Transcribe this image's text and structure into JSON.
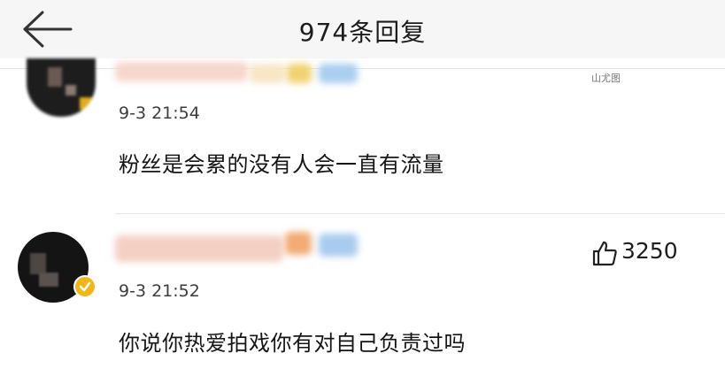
{
  "header": {
    "title": "974条回复",
    "back_icon": "back-arrow-icon"
  },
  "watermark": "山尤图",
  "comments": [
    {
      "time": "9-3 21:54",
      "content": "粉丝是会累的没有人会一直有流量"
    },
    {
      "time": "9-3 21:52",
      "content": "你说你热爱拍戏你有对自己负责过吗",
      "like_count": "3250",
      "like_icon": "thumbs-up-icon",
      "verified_badge": true
    }
  ],
  "colors": {
    "header_bg": "#f6f6f6",
    "badge": "#f3b617",
    "text": "#151515"
  }
}
